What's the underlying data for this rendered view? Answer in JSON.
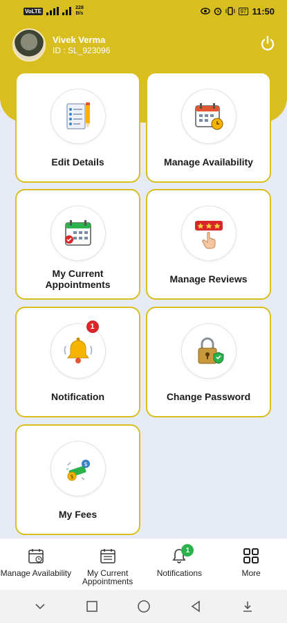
{
  "status_bar": {
    "volte_chip": "VoLTE",
    "speed_top": "228",
    "speed_bottom": "B/s",
    "battery": "97",
    "time": "11:50"
  },
  "header": {
    "user_name": "Vivek Verma",
    "user_id": "ID : SL_923096"
  },
  "tiles": [
    {
      "label": "Edit Details",
      "icon": "checklist-pencil-icon"
    },
    {
      "label": "Manage Availability",
      "icon": "calendar-clock-icon"
    },
    {
      "label": "My Current Appointments",
      "icon": "calendar-check-icon"
    },
    {
      "label": "Manage Reviews",
      "icon": "star-rating-icon"
    },
    {
      "label": "Notification",
      "icon": "bell-icon",
      "badge": "1"
    },
    {
      "label": "Change Password",
      "icon": "padlock-shield-icon"
    },
    {
      "label": "My Fees",
      "icon": "coins-money-icon"
    }
  ],
  "bottom_nav": [
    {
      "label": "Manage Availability",
      "icon": "calendar-icon"
    },
    {
      "label": "My Current Appointments",
      "icon": "calendar-list-icon"
    },
    {
      "label": "Notifications",
      "icon": "bell-icon",
      "badge": "1"
    },
    {
      "label": "More",
      "icon": "grid-icon"
    }
  ],
  "colors": {
    "accent": "#d8be1e",
    "badge_red": "#d8262a",
    "badge_green": "#2bb24c",
    "background": "#e6ebf5"
  }
}
